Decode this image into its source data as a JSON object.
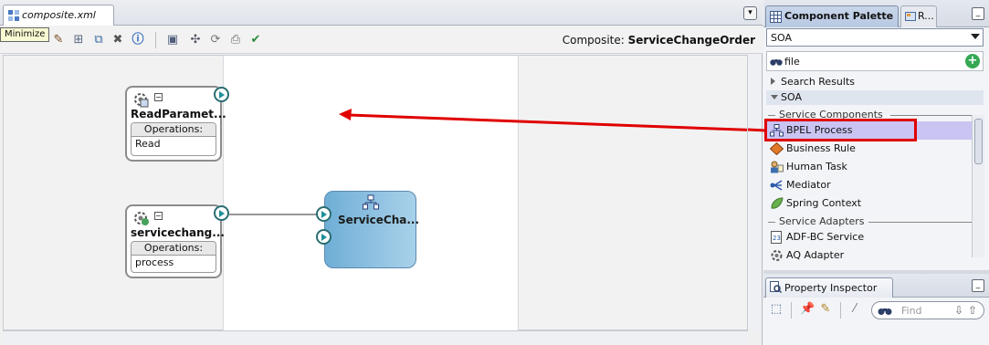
{
  "editor": {
    "tab_title": "composite.xml",
    "tooltip": "Minimize",
    "composite_prefix": "Composite: ",
    "composite_name": "ServiceChangeOrder"
  },
  "canvas": {
    "services": [
      {
        "title": "ReadParamet...",
        "ops_header": "Operations:",
        "operation": "Read"
      },
      {
        "title": "servicechang...",
        "ops_header": "Operations:",
        "operation": "process"
      }
    ],
    "component": {
      "title": "ServiceCha..."
    }
  },
  "palette": {
    "tab_title": "Component Palette",
    "second_tab_title": "R...",
    "selected_category": "SOA",
    "search_value": "file",
    "search_results_label": "Search Results",
    "soa_label": "SOA",
    "service_components_header": "Service Components",
    "service_components": [
      "BPEL Process",
      "Business Rule",
      "Human Task",
      "Mediator",
      "Spring Context"
    ],
    "service_adapters_header": "Service Adapters",
    "service_adapters": [
      "ADF-BC Service",
      "AQ Adapter"
    ]
  },
  "inspector": {
    "tab_title": "Property Inspector",
    "find_placeholder": "Find"
  },
  "colors": {
    "highlight": "#e00000",
    "component_fill": "#8cc0e2",
    "selected_item": "#c9c4f2",
    "port": "#1f8f98"
  }
}
